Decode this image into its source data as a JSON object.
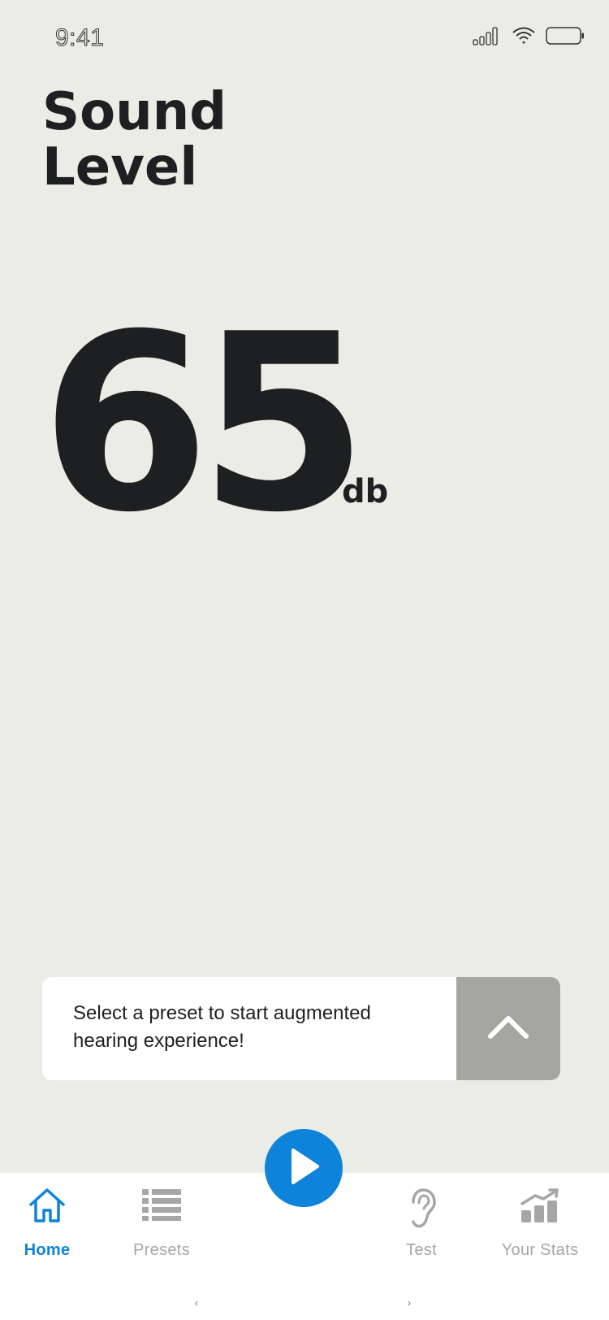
{
  "status_bar": {
    "time": "9:41",
    "icons": [
      "cellular-signal-icon",
      "wifi-icon",
      "battery-icon"
    ]
  },
  "header": {
    "title_line1": "Sound",
    "title_line2": "Level"
  },
  "sound_level": {
    "value": "65",
    "unit": "db"
  },
  "preset_card": {
    "message": "Select a preset to start augmented hearing experience!",
    "expand_icon": "chevron-up-icon"
  },
  "play_button": {
    "icon": "play-icon"
  },
  "tab_bar": {
    "tabs": [
      {
        "label": "Home",
        "icon": "home-icon",
        "active": true
      },
      {
        "label": "Presets",
        "icon": "list-icon",
        "active": false
      },
      {
        "label": "Test",
        "icon": "ear-icon",
        "active": false
      },
      {
        "label": "Your Stats",
        "icon": "stats-chart-icon",
        "active": false
      }
    ]
  },
  "colors": {
    "background": "#ECECE7",
    "text": "#1E1F21",
    "accent": "#0D84D9",
    "inactive": "#A6A6A6",
    "expand_button": "#A6A6A0"
  }
}
